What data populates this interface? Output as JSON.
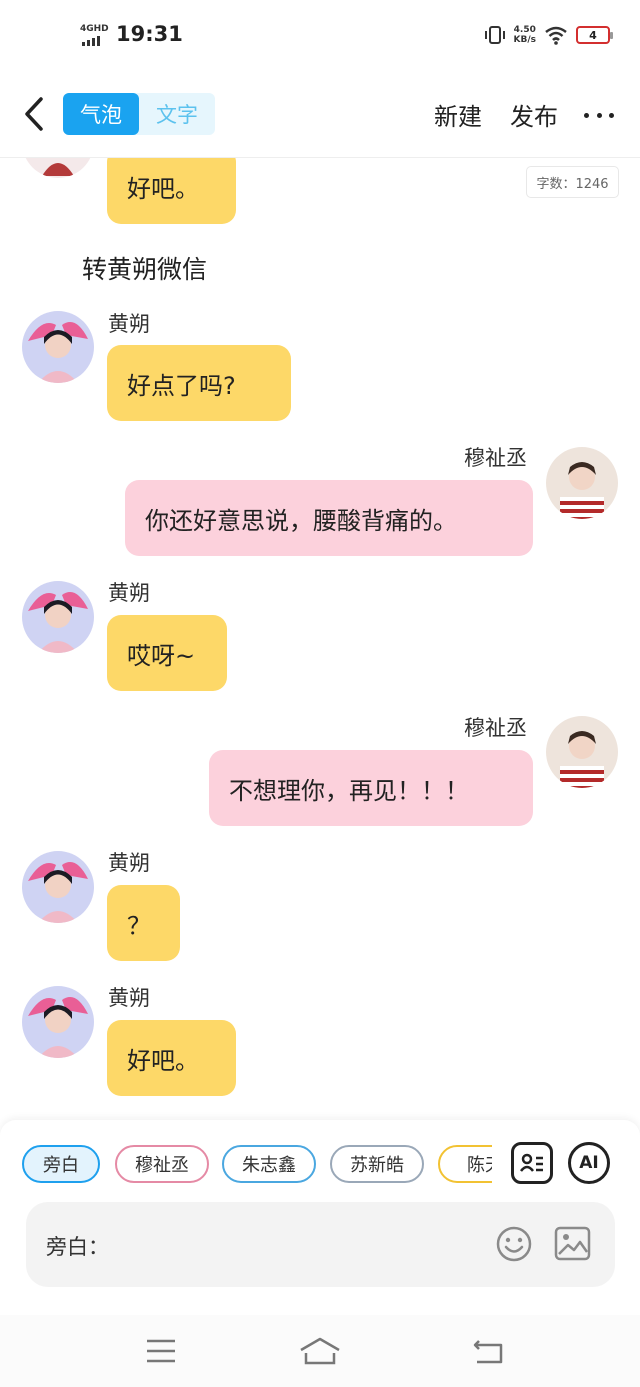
{
  "status_bar": {
    "network": "4GHD",
    "time": "19:31",
    "speed_value": "4.50",
    "speed_unit": "KB/s",
    "battery": "4",
    "icons": [
      "signal-icon",
      "vibrate-icon",
      "wifi-icon",
      "battery-icon"
    ]
  },
  "header": {
    "back_icon": "chevron-left-icon",
    "tabs": [
      {
        "label": "气泡",
        "active": true
      },
      {
        "label": "文字",
        "active": false
      }
    ],
    "new_label": "新建",
    "publish_label": "发布",
    "more_icon": "more-dots-icon"
  },
  "chat": {
    "word_count": "字数：1246",
    "narration": "转黄朔微信",
    "messages": [
      {
        "sender": "",
        "text": "好吧。",
        "side": "left"
      },
      {
        "sender": "黄朔",
        "text": "好点了吗?",
        "side": "left"
      },
      {
        "sender": "穆祉丞",
        "text": "你还好意思说，腰酸背痛的。",
        "side": "right"
      },
      {
        "sender": "黄朔",
        "text": "哎呀~",
        "side": "left"
      },
      {
        "sender": "穆祉丞",
        "text": "不想理你，再见！！！",
        "side": "right"
      },
      {
        "sender": "黄朔",
        "text": "？",
        "side": "left"
      },
      {
        "sender": "黄朔",
        "text": "好吧。",
        "side": "left"
      }
    ]
  },
  "composer": {
    "roles": [
      {
        "label": "旁白",
        "color": "#1ea0ee",
        "active": true
      },
      {
        "label": "穆祉丞",
        "color": "#e58aa5",
        "active": false
      },
      {
        "label": "朱志鑫",
        "color": "#4aa7e0",
        "active": false
      },
      {
        "label": "苏新皓",
        "color": "#9aa8b8",
        "active": false
      },
      {
        "label": "陈天",
        "color": "#f2c233",
        "active": false
      }
    ],
    "ai_label": "AI",
    "input_prefix": "旁白：",
    "input_value": "",
    "input_placeholder": "",
    "icons": [
      "role-card-icon",
      "ai-icon",
      "emoji-icon",
      "image-icon"
    ]
  },
  "system_nav": {
    "icons": [
      "menu-icon",
      "home-icon",
      "back-icon"
    ]
  },
  "colors": {
    "accent": "#1aa3f0",
    "bubble_left": "#fdd868",
    "bubble_right": "#fcd1dc"
  }
}
